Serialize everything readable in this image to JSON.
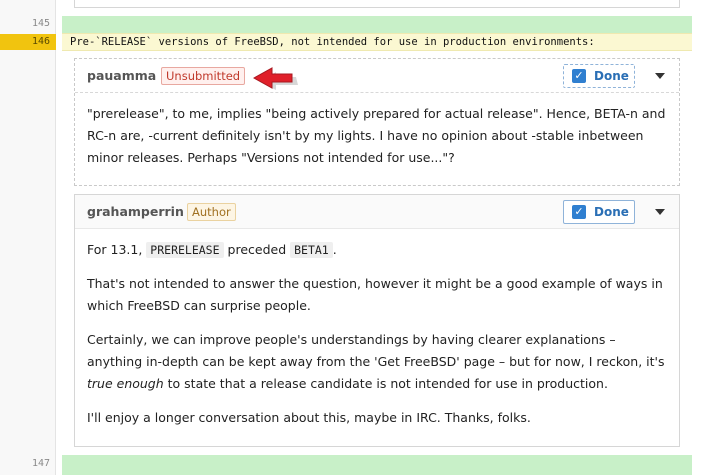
{
  "diff": {
    "line_145": "145",
    "line_146": "146",
    "line_147": "147",
    "code_text": "Pre-`RELEASE` versions of FreeBSD, not intended for use in production environments:"
  },
  "comments": [
    {
      "author": "pauamma",
      "tag": "Unsubmitted",
      "done_label": "Done",
      "paragraphs": [
        "\"prerelease\", to me, implies \"being actively prepared for actual release\". Hence, BETA-n and RC-n are, -current definitely isn't by my lights. I have no opinion about -stable inbetween minor releases. Perhaps \"Versions not intended for use...\"?"
      ]
    },
    {
      "author": "grahamperrin",
      "tag": "Author",
      "done_label": "Done",
      "p1": {
        "a": "For 13.1, ",
        "code1": "PRERELEASE",
        "b": " preceded ",
        "code2": "BETA1",
        "c": "."
      },
      "p2": "That's not intended to answer the question, however it might be a good example of ways in which FreeBSD can surprise people.",
      "p3": {
        "a": "Certainly, we can improve people's understandings by having clearer explanations – anything in-depth can be kept away from the 'Get FreeBSD' page – but for now, I reckon, it's ",
        "em": "true enough",
        "b": " to state that a release candidate is not intended for use in production."
      },
      "p4": "I'll enjoy a longer conversation about this, maybe in IRC. Thanks, folks."
    }
  ],
  "icons": {
    "check": "checkbox-check-icon",
    "caret": "chevron-down-icon",
    "arrow": "red-arrow-icon"
  },
  "colors": {
    "accent": "#2f7fd0",
    "unsubmitted": "#c0392b",
    "author_tag": "#a07020",
    "added_line": "#c8f0c8",
    "highlight_line": "#f1c40f"
  }
}
